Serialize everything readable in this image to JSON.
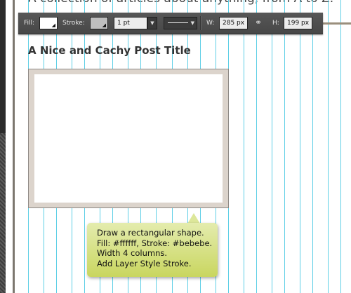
{
  "header": {
    "subtitle": "A collection of articles about anything, from A to Z."
  },
  "options_bar": {
    "fill_label": "Fill:",
    "fill_color": "#ffffff",
    "stroke_label": "Stroke:",
    "stroke_color": "#bebebe",
    "stroke_width": "1 pt",
    "width_label": "W:",
    "width_value": "285 px",
    "height_label": "H:",
    "height_value": "199 px"
  },
  "post": {
    "title": "A Nice and Cachy Post Title"
  },
  "tooltip": {
    "lines": [
      "Draw a rectangular shape.",
      "Fill: #ffffff, Stroke: #bebebe.",
      "Width 4 columns.",
      "Add Layer Style Stroke."
    ]
  },
  "colors": {
    "guide": "#5ecfe6",
    "rect_stroke": "#dcd4cc",
    "tooltip_bg": "#d6df85"
  },
  "icons": {
    "link": "link-icon",
    "dropdown": "chevron-down-icon"
  }
}
